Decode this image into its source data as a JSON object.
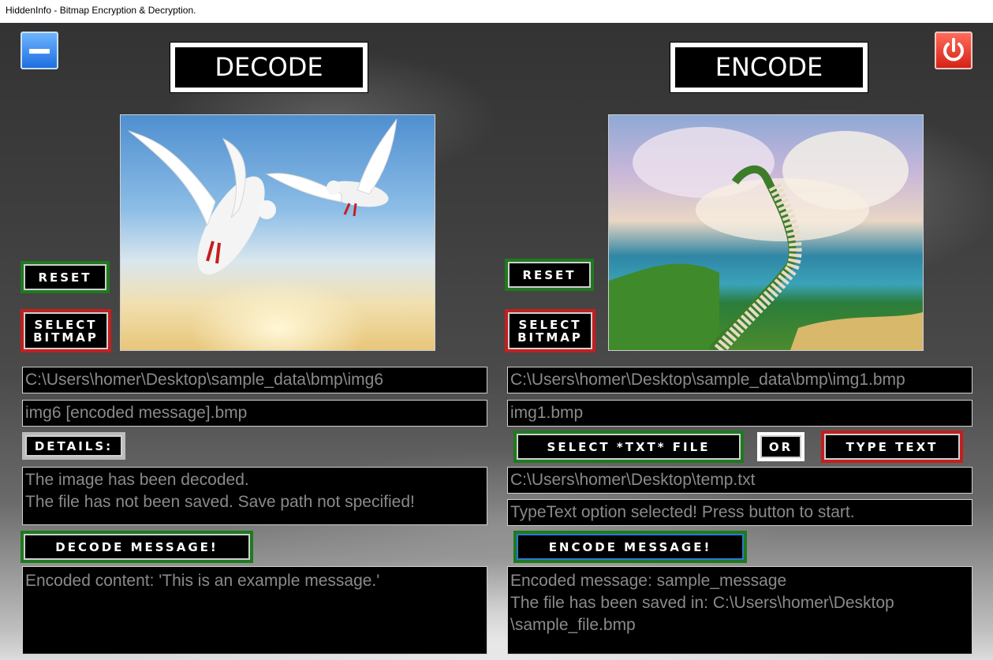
{
  "window": {
    "title": "HiddenInfo - Bitmap Encryption & Decryption."
  },
  "icons": {
    "minimize": "minimize-icon",
    "power": "power-icon"
  },
  "decode": {
    "heading": "DECODE",
    "reset_label": "RESET",
    "select_bitmap_label": "SELECT\nBITMAP",
    "path": "C:\\Users\\homer\\Desktop\\sample_data\\bmp\\img6",
    "filename": "img6 [encoded message].bmp",
    "details_label": "DETAILS:",
    "status": "The image has been decoded.\nThe file has not been saved. Save path not specified!",
    "action_label": "DECODE MESSAGE!",
    "output": "Encoded content: 'This is an example message.'"
  },
  "encode": {
    "heading": "ENCODE",
    "reset_label": "RESET",
    "select_bitmap_label": "SELECT\nBITMAP",
    "path": "C:\\Users\\homer\\Desktop\\sample_data\\bmp\\img1.bmp",
    "filename": "img1.bmp",
    "select_txt_label": "SELECT *TXT* FILE",
    "or_label": "OR",
    "type_text_label": "TYPE TEXT",
    "txt_path": "C:\\Users\\homer\\Desktop\\temp.txt",
    "status": "TypeText option selected! Press button to start.",
    "action_label": "ENCODE MESSAGE!",
    "output": "Encoded message: sample_message\nThe file has been saved in: C:\\Users\\homer\\Desktop\n\\sample_file.bmp"
  },
  "colors": {
    "green_border": "#1f7a1f",
    "red_border": "#c41e1e",
    "field_text": "#8a8a8a"
  }
}
